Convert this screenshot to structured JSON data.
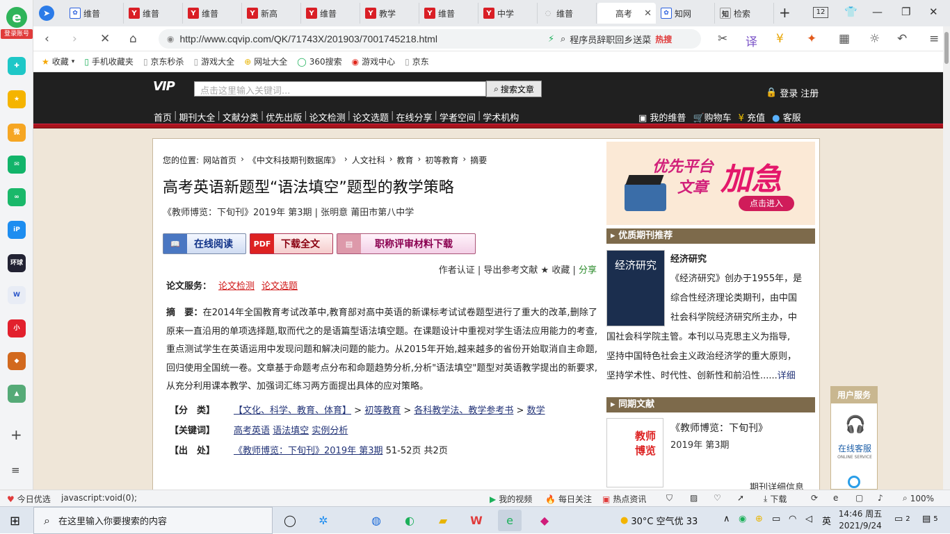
{
  "sidebar": {
    "login_label": "登录账号",
    "apps": [
      "消息",
      "收藏",
      "微博",
      "邮箱",
      "云盘",
      "iP",
      "环球网校",
      "文档",
      "小红书",
      "游戏",
      "游戏2"
    ]
  },
  "tabs": [
    {
      "label": "维普",
      "icon": "baidu-paw-icon"
    },
    {
      "label": "维普",
      "icon": "cqvip-icon"
    },
    {
      "label": "维普",
      "icon": "cqvip-icon"
    },
    {
      "label": "新高",
      "icon": "cqvip-icon"
    },
    {
      "label": "维普",
      "icon": "cqvip-icon"
    },
    {
      "label": "教学",
      "icon": "cqvip-icon"
    },
    {
      "label": "维普",
      "icon": "cqvip-icon"
    },
    {
      "label": "中学",
      "icon": "cqvip-icon"
    },
    {
      "label": "维普",
      "icon": "loading-icon"
    },
    {
      "label": "高考",
      "icon": "blank-icon",
      "active": true
    },
    {
      "label": "知网",
      "icon": "baidu-paw-icon"
    },
    {
      "label": "检索",
      "icon": "zhi-icon"
    }
  ],
  "tab_count": "12",
  "address": {
    "url": "http://www.cqvip.com/QK/71743X/201903/7001745218.html"
  },
  "search": {
    "text": "程序员辞职回乡送菜",
    "hot": "热搜"
  },
  "bookmarks": [
    "收藏",
    "手机收藏夹",
    "京东秒杀",
    "游戏大全",
    "网址大全",
    "360搜索",
    "游戏中心",
    "京东"
  ],
  "site": {
    "logo": "VIP",
    "search_placeholder": "点击这里输入关键词...",
    "search_button": "搜索文章",
    "login": "登录",
    "register": "注册",
    "nav": [
      "首页",
      "期刊大全",
      "文献分类",
      "优先出版",
      "论文检测",
      "论文选题",
      "在线分享",
      "学者空间",
      "学术机构"
    ],
    "user_nav": [
      "我的维普",
      "购物车",
      "充值",
      "客服"
    ]
  },
  "article": {
    "breadcrumb_label": "您的位置:",
    "breadcrumb": [
      "网站首页",
      "《中文科技期刊数据库》",
      "人文社科",
      "教育",
      "初等教育",
      "摘要"
    ],
    "title": "高考英语新题型“语法填空”题型的教学策略",
    "source": "《教师博览：下旬刊》2019年 第3期 | 张明意   莆田市第八中学",
    "buttons": {
      "read": "在线阅读",
      "download": "下载全文",
      "materials": "职称评审材料下载"
    },
    "links": {
      "author": "作者认证",
      "export": "导出参考文献",
      "collect": "★ 收藏",
      "share": "分享"
    },
    "service_label": "论文服务：",
    "service_links": [
      "论文检测",
      "论文选题"
    ],
    "abstract_label": "摘　要：",
    "abstract": "在2014年全国教育考试改革中,教育部对高中英语的新课标考试试卷题型进行了重大的改革,删除了原来一直沿用的单项选择题,取而代之的是语篇型语法填空题。在课题设计中重视对学生语法应用能力的考查,重点测试学生在英语运用中发现问题和解决问题的能力。从2015年开始,越来越多的省份开始取消自主命题,回归使用全国统一卷。文章基于命题考点分布和命题趋势分析,分析\"语法填空\"题型对英语教学提出的新要求,从充分利用课本教学、加强词汇练习两方面提出具体的应对策略。",
    "classify_label": "【分　类】",
    "classify": [
      "【文化、科学、教育、体育】",
      "初等教育",
      "各科教学法、教学参考书",
      "数学"
    ],
    "keywords_label": "【关键词】",
    "keywords": [
      "高考英语",
      "语法填空",
      "实例分析"
    ],
    "origin_label": "【出　处】",
    "origin_link": "《教师博览：下旬刊》2019年 第3期",
    "origin_pages": "51-52页 共2页"
  },
  "right": {
    "banner_line1": "优先平台",
    "banner_line2": "文章",
    "banner_big": "加急",
    "banner_btn": "点击进入",
    "rec_header": "优质期刊推荐",
    "journal_name": "经济研究",
    "journal_cover_text": "经济研究",
    "journal_desc_lines": [
      "《经济研究》创办于1955年，是",
      "综合性经济理论类期刊，由中国",
      "社会科学院经济研究所主办，中"
    ],
    "journal_desc_full": [
      "国社会科学院主管。本刊以马克思主义为指导,",
      "坚持中国特色社会主义政治经济学的重大原则，",
      "坚持学术性、时代性、创新性和前沿性......"
    ],
    "journal_more": "详细",
    "same_header": "同期文献",
    "same_journal": "《教师博览：下旬刊》",
    "same_issue": "2019年 第3期",
    "same_detail": "期刊详细信息",
    "same_cover_text": "教师博览"
  },
  "user_service": {
    "title": "用户服务",
    "online": "在线客服",
    "online_en": "ONLINE SERVICE"
  },
  "statusbar": {
    "left": "今日优选",
    "js": "javascript:void(0);",
    "items": [
      "我的视频",
      "每日关注",
      "热点资讯",
      "下载",
      "100%"
    ]
  },
  "taskbar": {
    "search": "在这里输入你要搜索的内容",
    "weather": "30°C  空气优 33",
    "ime": "英",
    "time": "14:46 周五",
    "date": "2021/9/24",
    "notif": "5",
    "msg": "2"
  }
}
